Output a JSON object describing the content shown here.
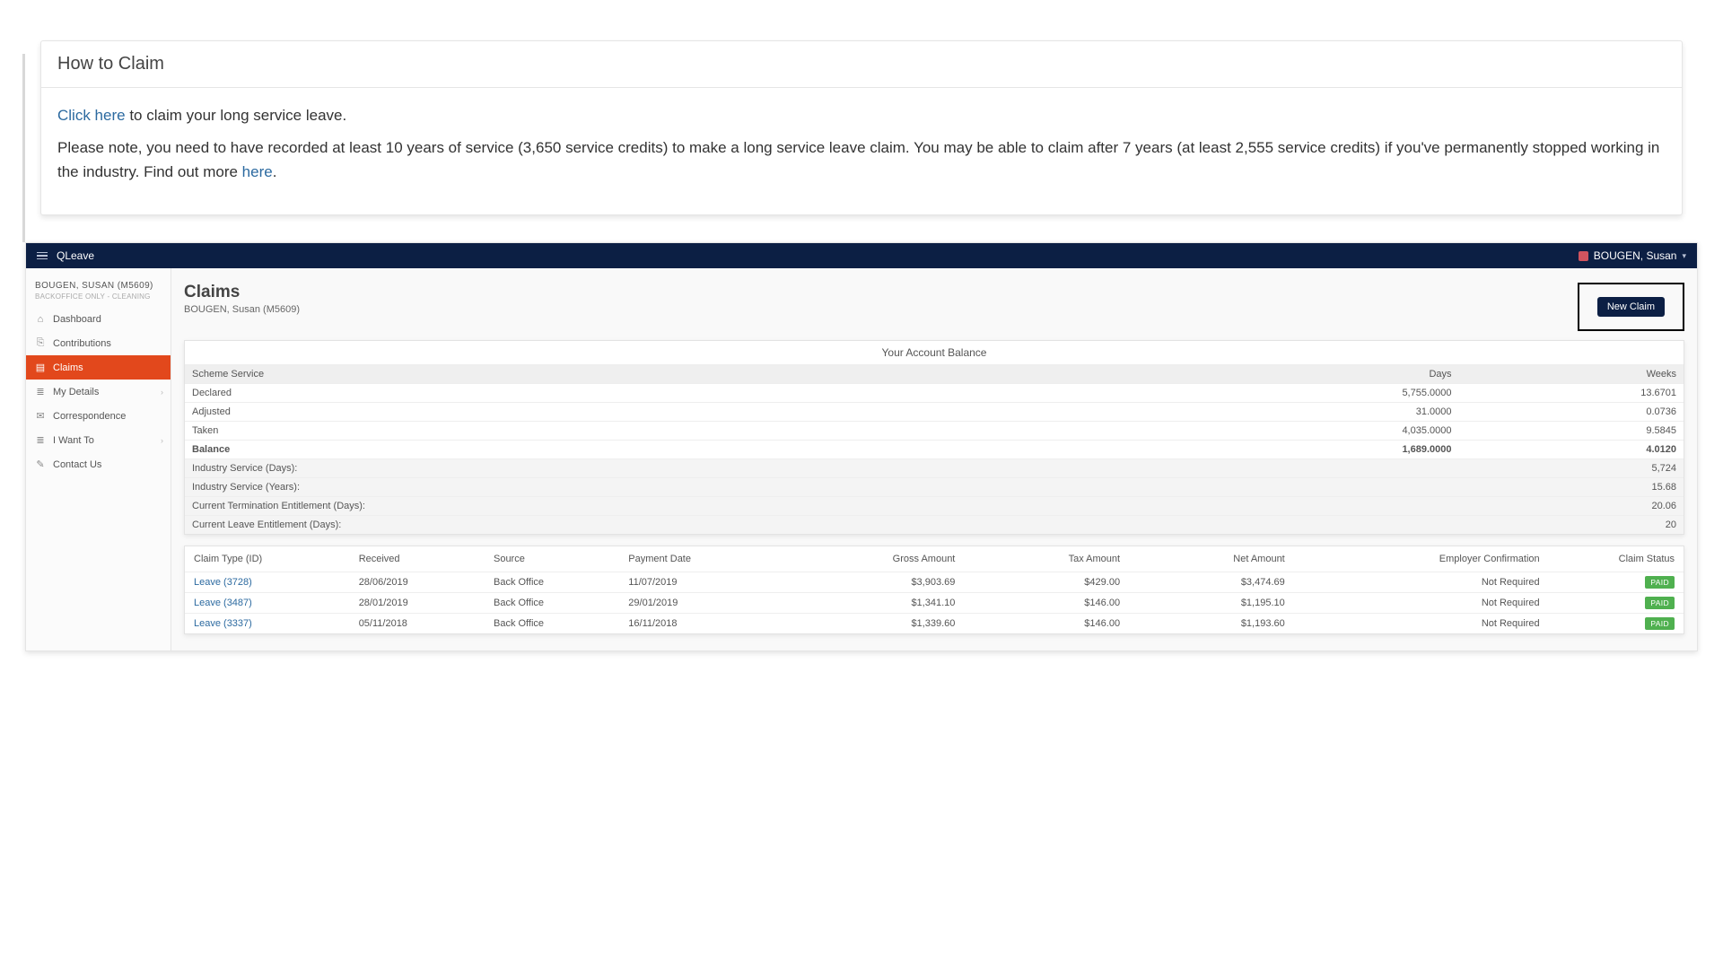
{
  "info_card": {
    "title": "How to Claim",
    "link_text": "Click here",
    "body_after_link": " to claim your long service leave.",
    "body2_before": "Please note, you need to have recorded at least 10 years of service (3,650 service credits) to make a long service leave claim. You may be able to claim after 7 years (at least 2,555 service credits) if you've permanently stopped working in the industry. Find out more ",
    "body2_link": "here",
    "body2_after": "."
  },
  "app": {
    "brand": "QLeave",
    "user_display": "BOUGEN, Susan"
  },
  "sidebar": {
    "user_name": "BOUGEN, SUSAN (M5609)",
    "user_sub": "BACKOFFICE ONLY - CLEANING",
    "items": [
      {
        "label": "Dashboard",
        "icon": "⌂",
        "active": false,
        "has_sub": false
      },
      {
        "label": "Contributions",
        "icon": "⎘",
        "active": false,
        "has_sub": false
      },
      {
        "label": "Claims",
        "icon": "▤",
        "active": true,
        "has_sub": false
      },
      {
        "label": "My Details",
        "icon": "≣",
        "active": false,
        "has_sub": true
      },
      {
        "label": "Correspondence",
        "icon": "✉",
        "active": false,
        "has_sub": false
      },
      {
        "label": "I Want To",
        "icon": "≣",
        "active": false,
        "has_sub": true
      },
      {
        "label": "Contact Us",
        "icon": "✎",
        "active": false,
        "has_sub": false
      }
    ]
  },
  "main": {
    "title": "Claims",
    "subtitle": "BOUGEN, Susan (M5609)",
    "new_claim_label": "New Claim",
    "balance_title": "Your Account Balance",
    "balance_head": {
      "scheme": "Scheme Service",
      "days": "Days",
      "weeks": "Weeks"
    },
    "balance_rows": [
      {
        "label": "Declared",
        "days": "5,755.0000",
        "weeks": "13.6701"
      },
      {
        "label": "Adjusted",
        "days": "31.0000",
        "weeks": "0.0736"
      },
      {
        "label": "Taken",
        "days": "4,035.0000",
        "weeks": "9.5845"
      },
      {
        "label": "Balance",
        "days": "1,689.0000",
        "weeks": "4.0120",
        "bold": true
      }
    ],
    "balance_extra": [
      {
        "label": "Industry Service (Days):",
        "value": "5,724"
      },
      {
        "label": "Industry Service (Years):",
        "value": "15.68"
      },
      {
        "label": "Current Termination Entitlement (Days):",
        "value": "20.06"
      },
      {
        "label": "Current Leave Entitlement (Days):",
        "value": "20"
      }
    ],
    "claims_head": {
      "type": "Claim Type (ID)",
      "received": "Received",
      "source": "Source",
      "payment": "Payment Date",
      "gross": "Gross Amount",
      "tax": "Tax Amount",
      "net": "Net Amount",
      "conf": "Employer Confirmation",
      "status": "Claim Status"
    },
    "claims_rows": [
      {
        "type": "Leave (3728)",
        "received": "28/06/2019",
        "source": "Back Office",
        "payment": "11/07/2019",
        "gross": "$3,903.69",
        "tax": "$429.00",
        "net": "$3,474.69",
        "conf": "Not Required",
        "status": "PAID"
      },
      {
        "type": "Leave (3487)",
        "received": "28/01/2019",
        "source": "Back Office",
        "payment": "29/01/2019",
        "gross": "$1,341.10",
        "tax": "$146.00",
        "net": "$1,195.10",
        "conf": "Not Required",
        "status": "PAID"
      },
      {
        "type": "Leave (3337)",
        "received": "05/11/2018",
        "source": "Back Office",
        "payment": "16/11/2018",
        "gross": "$1,339.60",
        "tax": "$146.00",
        "net": "$1,193.60",
        "conf": "Not Required",
        "status": "PAID"
      }
    ]
  }
}
